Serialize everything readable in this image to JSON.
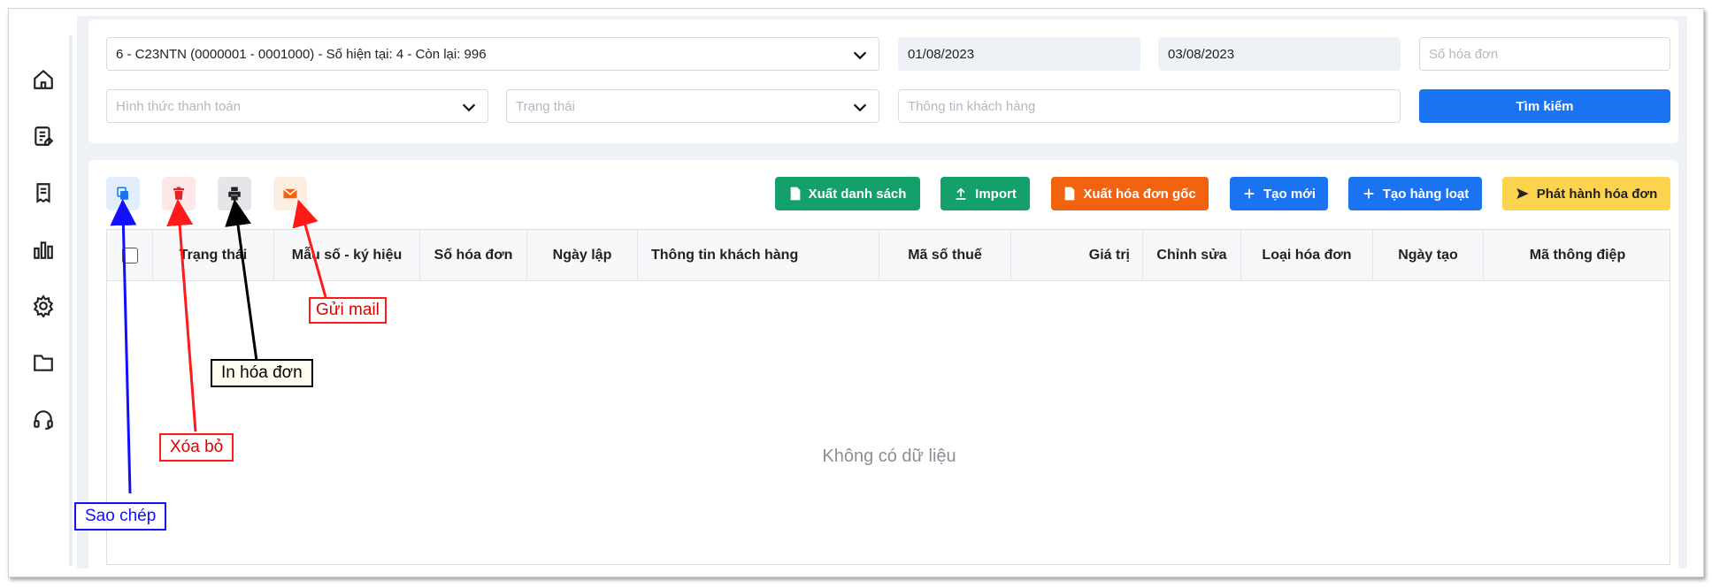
{
  "filters": {
    "series_select": "6 - C23NTN (0000001 - 0001000) - Số hiện tại: 4 - Còn lại: 996",
    "from_date": "01/08/2023",
    "to_date": "03/08/2023",
    "invoice_number_placeholder": "Số hóa đơn",
    "payment_method_placeholder": "Hình thức thanh toán",
    "status_placeholder": "Trạng thái",
    "customer_info_placeholder": "Thông tin khách hàng",
    "search_label": "Tìm kiếm"
  },
  "toolbar": {
    "export_list": "Xuất danh sách",
    "import": "Import",
    "export_original": "Xuất hóa đơn gốc",
    "create_new": "Tạo mới",
    "create_batch": "Tạo hàng loạt",
    "issue_invoice": "Phát hành hóa đơn"
  },
  "table": {
    "columns": [
      "Trạng thái",
      "Mẫu số - ký hiệu",
      "Số hóa đơn",
      "Ngày lập",
      "Thông tin khách hàng",
      "Mã số thuế",
      "Giá trị",
      "Chỉnh sửa",
      "Loại hóa đơn",
      "Ngày tạo",
      "Mã thông điệp"
    ],
    "empty_text": "Không có dữ liệu"
  },
  "annotations": {
    "copy": "Sao chép",
    "delete": "Xóa bỏ",
    "print": "In hóa đơn",
    "mail": "Gửi mail"
  },
  "colors": {
    "primary": "#1a73f0",
    "green": "#14a06a",
    "orange": "#f2620f",
    "yellow": "#fcd34d",
    "delete_red": "#e02424",
    "copy_blue": "#1a73f0"
  },
  "icons": [
    "home-icon",
    "document-icon",
    "receipt-icon",
    "bar-chart-icon",
    "gear-icon",
    "folder-icon",
    "headset-icon",
    "copy-icon",
    "trash-icon",
    "printer-icon",
    "mail-icon",
    "file-icon",
    "upload-icon",
    "plus-icon",
    "send-icon",
    "chevron-down-icon"
  ]
}
